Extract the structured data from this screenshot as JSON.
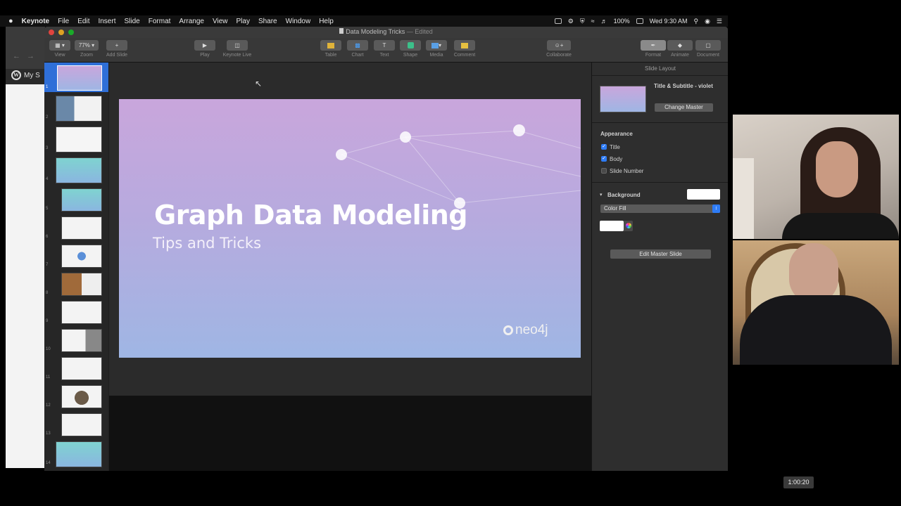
{
  "menubar": {
    "apple": "",
    "items": [
      "Keynote",
      "File",
      "Edit",
      "Insert",
      "Slide",
      "Format",
      "Arrange",
      "View",
      "Play",
      "Share",
      "Window",
      "Help"
    ],
    "battery": "100%",
    "clock": "Wed 9:30 AM"
  },
  "browser": {
    "site": "My S"
  },
  "window": {
    "doc_title": "Data Modeling Tricks",
    "edited": "— Edited"
  },
  "toolbar": {
    "view": "View",
    "zoom": "Zoom",
    "zoom_value": "77%",
    "add_slide": "Add Slide",
    "play": "Play",
    "keynote_live": "Keynote Live",
    "table": "Table",
    "chart": "Chart",
    "text": "Text",
    "shape": "Shape",
    "media": "Media",
    "comment": "Comment",
    "collaborate": "Collaborate",
    "format": "Format",
    "animate": "Animate",
    "document": "Document"
  },
  "navigator": {
    "slide_numbers": [
      "1",
      "2",
      "3",
      "4",
      "5",
      "6",
      "7",
      "8",
      "9",
      "10",
      "11",
      "12",
      "13",
      "14"
    ]
  },
  "slide": {
    "title": "Graph Data Modeling",
    "subtitle": "Tips and Tricks",
    "logo": "neo4j"
  },
  "inspector": {
    "header": "Slide Layout",
    "master_name": "Title & Subtitle - violet",
    "change_master": "Change Master",
    "appearance": "Appearance",
    "opt_title": "Title",
    "opt_body": "Body",
    "opt_slide_number": "Slide Number",
    "background": "Background",
    "fill_type": "Color Fill",
    "edit_master": "Edit Master Slide"
  },
  "video": {
    "timestamp": "1:00:20"
  },
  "colors": {
    "accent": "#2e7cf6",
    "slide_top": "#c9a6dc",
    "slide_bottom": "#9fb6e4"
  }
}
